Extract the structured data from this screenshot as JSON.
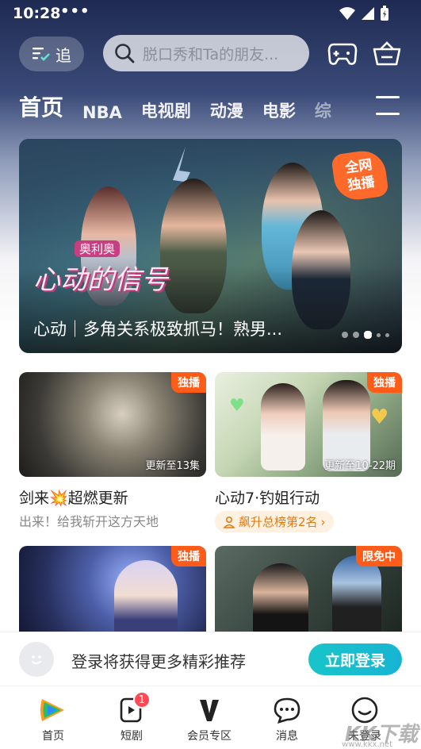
{
  "status_bar": {
    "time": "10:28",
    "dots": "•••"
  },
  "top_bar": {
    "follow_label": "追",
    "search_placeholder": "脱口秀和Ta的朋友..."
  },
  "nav": {
    "tabs": [
      {
        "label": "首页",
        "active": true
      },
      {
        "label": "NBA"
      },
      {
        "label": "电视剧"
      },
      {
        "label": "动漫"
      },
      {
        "label": "电影"
      },
      {
        "label": "综"
      }
    ]
  },
  "banner": {
    "caption": "心动｜多角关系极致抓马！熟男...",
    "logo_text": "心动的信号",
    "logo_sub": "奥利奥",
    "seal": [
      "全网",
      "独播"
    ],
    "pager_count": 5,
    "pager_active": 2
  },
  "cards": [
    {
      "tag": "独播",
      "update": "更新至13集",
      "title": "剑来💥超燃更新",
      "subtitle": "出来！给我斩开这方天地",
      "accent": "#6c6a5f"
    },
    {
      "tag": "独播",
      "update": "更新至10-22期",
      "title": "心动7·钓姐行动",
      "rank": "飙升总榜第2名",
      "accent": "#b3c9a7"
    },
    {
      "tag": "独播",
      "accent": "#3d4e8f"
    },
    {
      "tag": "限免中",
      "accent": "#3b4a44"
    }
  ],
  "login_prompt": {
    "text": "登录将获得更多精彩推荐",
    "button": "立即登录"
  },
  "tab_bar": {
    "items": [
      {
        "label": "首页",
        "icon": "tencent-video-logo-icon"
      },
      {
        "label": "短剧",
        "icon": "short-drama-icon",
        "badge": "1"
      },
      {
        "label": "会员专区",
        "icon": "vip-v-icon"
      },
      {
        "label": "消息",
        "icon": "message-icon"
      },
      {
        "label": "未登录",
        "icon": "profile-icon"
      }
    ]
  },
  "watermark": {
    "text": "KK下载",
    "url": "www.kkx.net"
  },
  "colors": {
    "accent": "#18c5c9",
    "tag": "#ff5c1a",
    "badge": "#ff4a55"
  }
}
